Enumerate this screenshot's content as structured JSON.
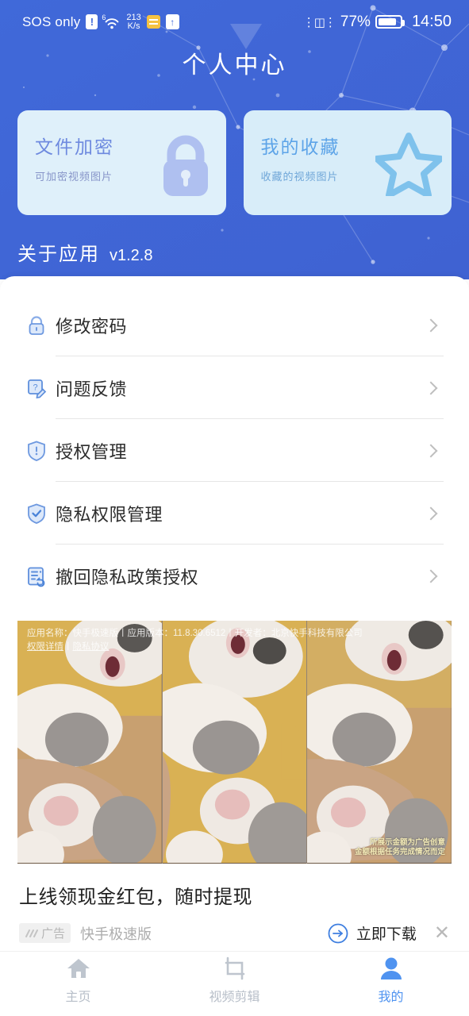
{
  "statusbar": {
    "carrier": "SOS only",
    "sim_alert_glyph": "!",
    "wifi_gen": "6",
    "netspeed_value": "213",
    "netspeed_unit": "K/s",
    "battery_percent": "77%",
    "clock": "14:50",
    "icons": [
      "sim-alert-icon",
      "wifi-icon",
      "network-speed",
      "notes-icon",
      "upload-icon",
      "vibrate-icon",
      "battery-icon"
    ]
  },
  "header": {
    "title": "个人中心",
    "background_color": "#4069D9",
    "cards": [
      {
        "title": "文件加密",
        "subtitle": "可加密视频图片",
        "icon": "lock-icon",
        "bg": "#DFF0FA",
        "title_color": "#6E8ADF"
      },
      {
        "title": "我的收藏",
        "subtitle": "收藏的视频图片",
        "icon": "star-icon",
        "bg": "#D8EDF9",
        "title_color": "#5DA4E8"
      }
    ],
    "about_label": "关于应用",
    "about_version": "v1.2.8"
  },
  "settings_list": [
    {
      "label": "修改密码",
      "icon": "lock-icon"
    },
    {
      "label": "问题反馈",
      "icon": "feedback-pencil-icon"
    },
    {
      "label": "授权管理",
      "icon": "shield-exclamation-icon"
    },
    {
      "label": "隐私权限管理",
      "icon": "shield-check-icon"
    },
    {
      "label": "撤回隐私政策授权",
      "icon": "document-revoke-icon"
    }
  ],
  "ad": {
    "legal_line1": "应用名称：快手极速版丨应用版本：11.8.30.6512丨开发者：北京快手科技有限公司",
    "legal_permissions": "权限详情",
    "legal_separator": "丨",
    "legal_privacy": "隐私协议",
    "amount_note_line1": "所展示金额为广告创意",
    "amount_note_line2": "金额根据任务完成情况而定",
    "headline": "上线领现金红包，随时提现",
    "tag": "广告",
    "brand": "快手极速版",
    "cta": "立即下载",
    "cta_icon": "arrow-right-circle-icon",
    "close_icon": "close-icon"
  },
  "bottomnav": {
    "items": [
      {
        "label": "主页",
        "icon": "home-icon",
        "active": false
      },
      {
        "label": "视频剪辑",
        "icon": "crop-icon",
        "active": false
      },
      {
        "label": "我的",
        "icon": "person-icon",
        "active": true
      }
    ],
    "active_color": "#4F93F0",
    "inactive_color": "#B7BEC8"
  }
}
